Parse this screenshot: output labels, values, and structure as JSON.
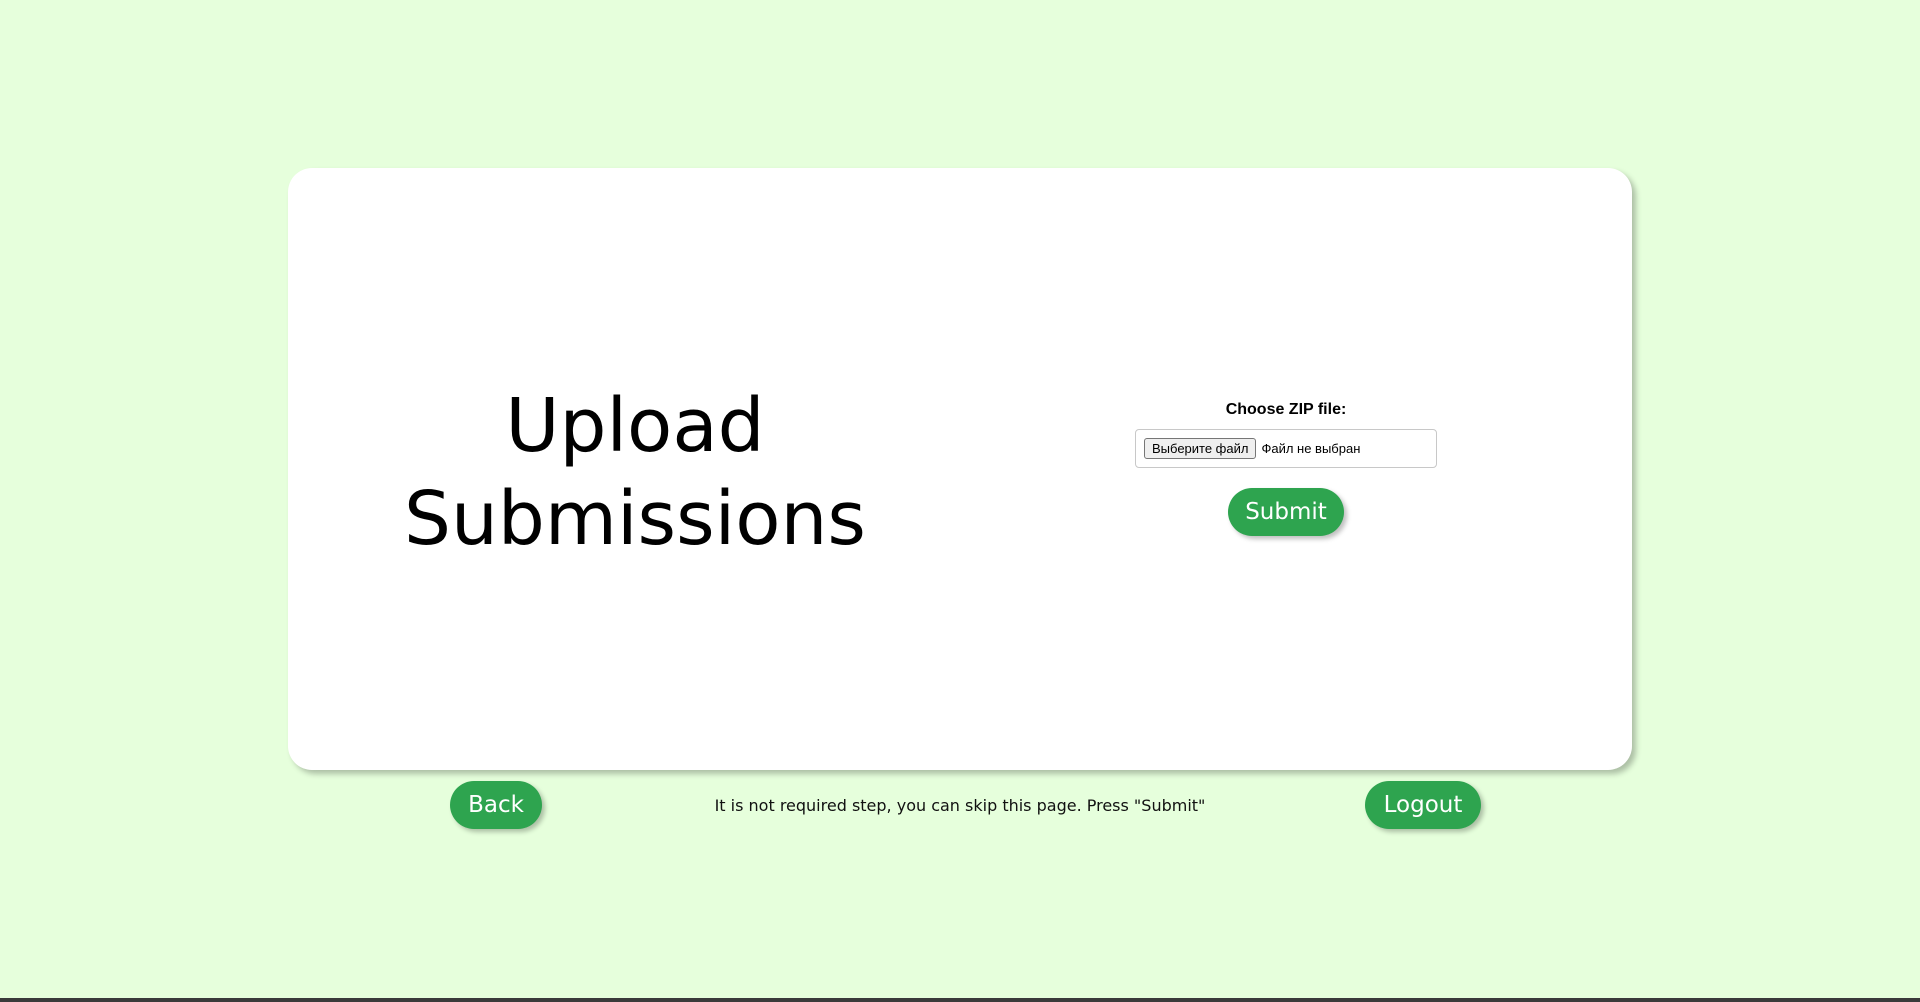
{
  "page": {
    "title_line1": "Upload",
    "title_line2": "Submissions"
  },
  "upload": {
    "label": "Choose ZIP file:",
    "file_button_label": "Выберите файл",
    "file_status": "Файл не выбран",
    "submit_label": "Submit"
  },
  "footer": {
    "back_label": "Back",
    "hint": "It is not required step, you can skip this page. Press \"Submit\"",
    "logout_label": "Logout"
  },
  "colors": {
    "background": "#e6ffdc",
    "card": "#ffffff",
    "accent": "#2ea44f"
  }
}
